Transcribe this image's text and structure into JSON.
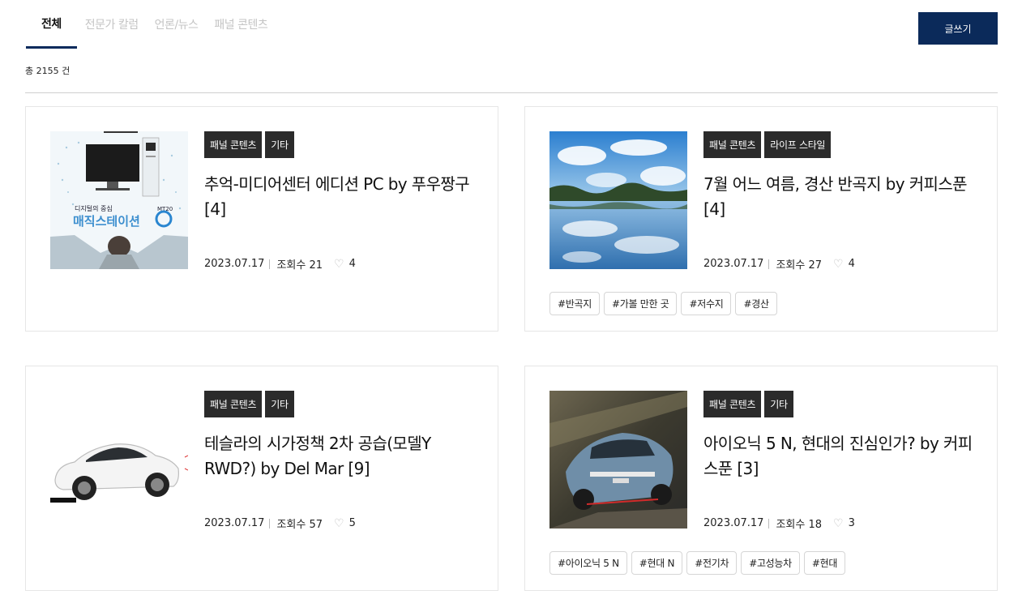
{
  "tabs": [
    {
      "label": "전체",
      "active": true
    },
    {
      "label": "전문가 칼럼",
      "active": false
    },
    {
      "label": "언론/뉴스",
      "active": false
    },
    {
      "label": "패널 콘텐츠",
      "active": false
    }
  ],
  "write_button": "글쓰기",
  "total_text": "총 2155 건",
  "posts": [
    {
      "categories": [
        "패널 콘텐츠",
        "기타"
      ],
      "title": "추억-미디어센터 에디션 PC by 푸우짱구 [4]",
      "date": "2023.07.17",
      "views": "조회수 21",
      "likes": "4",
      "tags": [],
      "thumb_text": [
        "디지털의 중심",
        "MT20",
        "매직스테이션"
      ]
    },
    {
      "categories": [
        "패널 콘텐츠",
        "라이프 스타일"
      ],
      "title": "7월 어느 여름, 경산 반곡지 by 커피스푼 [4]",
      "date": "2023.07.17",
      "views": "조회수 27",
      "likes": "4",
      "tags": [
        "#반곡지",
        "#가볼 만한 곳",
        "#저수지",
        "#경산"
      ]
    },
    {
      "categories": [
        "패널 콘텐츠",
        "기타"
      ],
      "title": "테슬라의 시가정책 2차 공습(모델Y RWD?) by Del Mar [9]",
      "date": "2023.07.17",
      "views": "조회수 57",
      "likes": "5",
      "tags": []
    },
    {
      "categories": [
        "패널 콘텐츠",
        "기타"
      ],
      "title": "아이오닉 5 N, 현대의 진심인가? by 커피스푼 [3]",
      "date": "2023.07.17",
      "views": "조회수 18",
      "likes": "3",
      "tags": [
        "#아이오닉 5 N",
        "#현대 N",
        "#전기차",
        "#고성능차",
        "#현대"
      ]
    }
  ],
  "icons": {
    "like": "heart-outline-icon"
  },
  "colors": {
    "accent": "#0b2a5a",
    "category_bg": "#2b2b2b",
    "inactive_tab": "#c4c4c4"
  }
}
